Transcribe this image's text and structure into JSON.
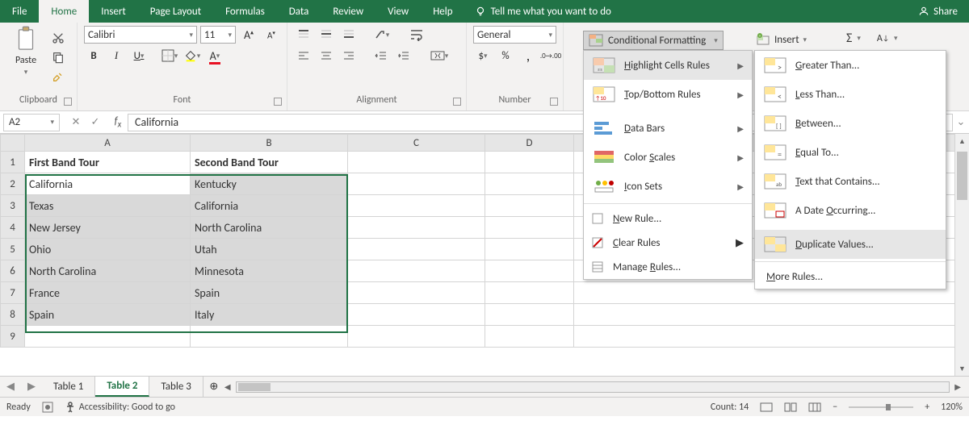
{
  "menubar": {
    "tabs": [
      "File",
      "Home",
      "Insert",
      "Page Layout",
      "Formulas",
      "Data",
      "Review",
      "View",
      "Help"
    ],
    "active": "Home",
    "tell": "Tell me what you want to do",
    "share": "Share"
  },
  "ribbon": {
    "groups": {
      "clipboard": "Clipboard",
      "font": "Font",
      "alignment": "Alignment",
      "number": "Number"
    },
    "paste": "Paste",
    "font_name": "Calibri",
    "font_size": "11",
    "number_format": "General",
    "cf_button": "Conditional Formatting",
    "insert_button": "Insert"
  },
  "cf_menu": {
    "highlight": "Highlight Cells Rules",
    "topbottom": "Top/Bottom Rules",
    "databars": "Data Bars",
    "colorscales": "Color Scales",
    "iconsets": "Icon Sets",
    "new_rule": "New Rule...",
    "clear_rules": "Clear Rules",
    "manage_rules": "Manage Rules..."
  },
  "cf_submenu": {
    "greater": "Greater Than...",
    "less": "Less Than...",
    "between": "Between...",
    "equal": "Equal To...",
    "text": "Text that Contains...",
    "date": "A Date Occurring...",
    "dup": "Duplicate Values...",
    "more": "More Rules..."
  },
  "formula_bar": {
    "namebox": "A2",
    "value": "California"
  },
  "columns": [
    "A",
    "B",
    "C",
    "D"
  ],
  "rows": [
    {
      "n": "1",
      "A": "First Band Tour",
      "B": "Second Band Tour",
      "hdr": true
    },
    {
      "n": "2",
      "A": "California",
      "B": "Kentucky"
    },
    {
      "n": "3",
      "A": "Texas",
      "B": "California"
    },
    {
      "n": "4",
      "A": "New Jersey",
      "B": "North Carolina"
    },
    {
      "n": "5",
      "A": "Ohio",
      "B": "Utah"
    },
    {
      "n": "6",
      "A": "North Carolina",
      "B": "Minnesota"
    },
    {
      "n": "7",
      "A": "France",
      "B": "Spain"
    },
    {
      "n": "8",
      "A": "Spain",
      "B": "Italy"
    },
    {
      "n": "9",
      "A": "",
      "B": ""
    }
  ],
  "sheet_tabs": {
    "tabs": [
      "Table 1",
      "Table 2",
      "Table 3"
    ],
    "active": "Table 2"
  },
  "status": {
    "ready": "Ready",
    "accessibility": "Accessibility: Good to go",
    "count_label": "Count:",
    "count_value": "14",
    "zoom": "120%"
  }
}
